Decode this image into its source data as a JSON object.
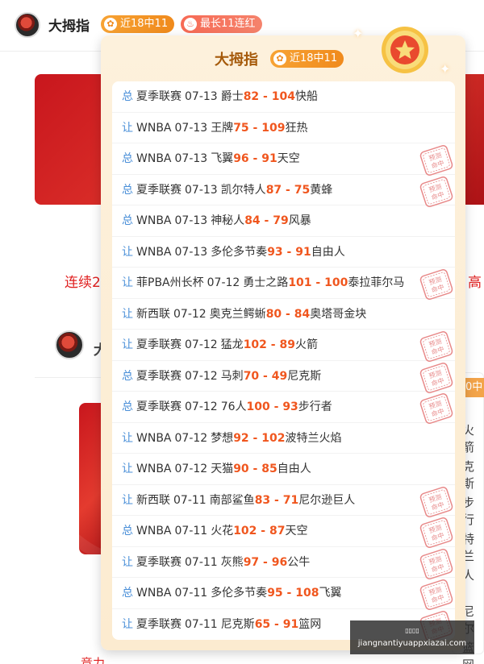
{
  "header": {
    "name": "大拇指",
    "badge_recent": "近18中11",
    "badge_streak": "最长11连红"
  },
  "background": {
    "red_text_left": "连续2",
    "red_text_right": "高",
    "author_initial": "大",
    "bottom_red_text": "竞力"
  },
  "popup": {
    "title": "大拇指",
    "badge": "近18中11",
    "stamp_text": "预测命中",
    "rows": [
      {
        "tag": "总",
        "league": "夏季联赛",
        "date": "07-13",
        "team_a": "爵士",
        "score_a": "82",
        "score_b": "104",
        "team_b": "快船",
        "hit": false
      },
      {
        "tag": "让",
        "league": "WNBA",
        "date": "07-13",
        "team_a": "王牌",
        "score_a": "75",
        "score_b": "109",
        "team_b": "狂热",
        "hit": false
      },
      {
        "tag": "总",
        "league": "WNBA",
        "date": "07-13",
        "team_a": "飞翼",
        "score_a": "96",
        "score_b": "91",
        "team_b": "天空",
        "hit": true
      },
      {
        "tag": "总",
        "league": "夏季联赛",
        "date": "07-13",
        "team_a": "凯尔特人",
        "score_a": "87",
        "score_b": "75",
        "team_b": "黄蜂",
        "hit": true
      },
      {
        "tag": "总",
        "league": "WNBA",
        "date": "07-13",
        "team_a": "神秘人",
        "score_a": "84",
        "score_b": "79",
        "team_b": "风暴",
        "hit": false
      },
      {
        "tag": "让",
        "league": "WNBA",
        "date": "07-13",
        "team_a": "多伦多节奏",
        "score_a": "93",
        "score_b": "91",
        "team_b": "自由人",
        "hit": false
      },
      {
        "tag": "让",
        "league": "菲PBA州长杯",
        "date": "07-12",
        "team_a": "勇士之路",
        "score_a": "101",
        "score_b": "100",
        "team_b": "泰拉菲尔马",
        "hit": true
      },
      {
        "tag": "让",
        "league": "新西联",
        "date": "07-12",
        "team_a": "奥克兰鳄蜥",
        "score_a": "80",
        "score_b": "84",
        "team_b": "奥塔哥金块",
        "hit": false
      },
      {
        "tag": "让",
        "league": "夏季联赛",
        "date": "07-12",
        "team_a": "猛龙",
        "score_a": "102",
        "score_b": "89",
        "team_b": "火箭",
        "hit": true
      },
      {
        "tag": "总",
        "league": "夏季联赛",
        "date": "07-12",
        "team_a": "马刺",
        "score_a": "70",
        "score_b": "49",
        "team_b": "尼克斯",
        "hit": true
      },
      {
        "tag": "总",
        "league": "夏季联赛",
        "date": "07-12",
        "team_a": "76人",
        "score_a": "100",
        "score_b": "93",
        "team_b": "步行者",
        "hit": true
      },
      {
        "tag": "让",
        "league": "WNBA",
        "date": "07-12",
        "team_a": "梦想",
        "score_a": "92",
        "score_b": "102",
        "team_b": "波特兰火焰",
        "hit": false
      },
      {
        "tag": "让",
        "league": "WNBA",
        "date": "07-12",
        "team_a": "天猫",
        "score_a": "90",
        "score_b": "85",
        "team_b": "自由人",
        "hit": false
      },
      {
        "tag": "让",
        "league": "新西联",
        "date": "07-11",
        "team_a": "南部鲨鱼",
        "score_a": "83",
        "score_b": "71",
        "team_b": "尼尔逊巨人",
        "hit": true
      },
      {
        "tag": "总",
        "league": "WNBA",
        "date": "07-11",
        "team_a": "火花",
        "score_a": "102",
        "score_b": "87",
        "team_b": "天空",
        "hit": true
      },
      {
        "tag": "让",
        "league": "夏季联赛",
        "date": "07-11",
        "team_a": "灰熊",
        "score_a": "97",
        "score_b": "96",
        "team_b": "公牛",
        "hit": true
      },
      {
        "tag": "总",
        "league": "WNBA",
        "date": "07-11",
        "team_a": "多伦多节奏",
        "score_a": "95",
        "score_b": "108",
        "team_b": "飞翼",
        "hit": true
      },
      {
        "tag": "让",
        "league": "夏季联赛",
        "date": "07-11",
        "team_a": "尼克斯",
        "score_a": "65",
        "score_b": "91",
        "team_b": "篮网",
        "hit": true
      }
    ]
  },
  "side_card": {
    "chip": "0中",
    "items": [
      "火箭",
      "克斯",
      "步行",
      "特兰",
      "人",
      "尼尔",
      "篮网"
    ]
  },
  "watermark": {
    "line1": "▯▯▯▯",
    "line2": "jiangnantiyuappxiazai.com"
  },
  "colors": {
    "accent": "#f08a1c",
    "score": "#f0561e",
    "tag": "#4a8fd8",
    "title": "#a55a0b",
    "stamp": "#e88a8a"
  }
}
